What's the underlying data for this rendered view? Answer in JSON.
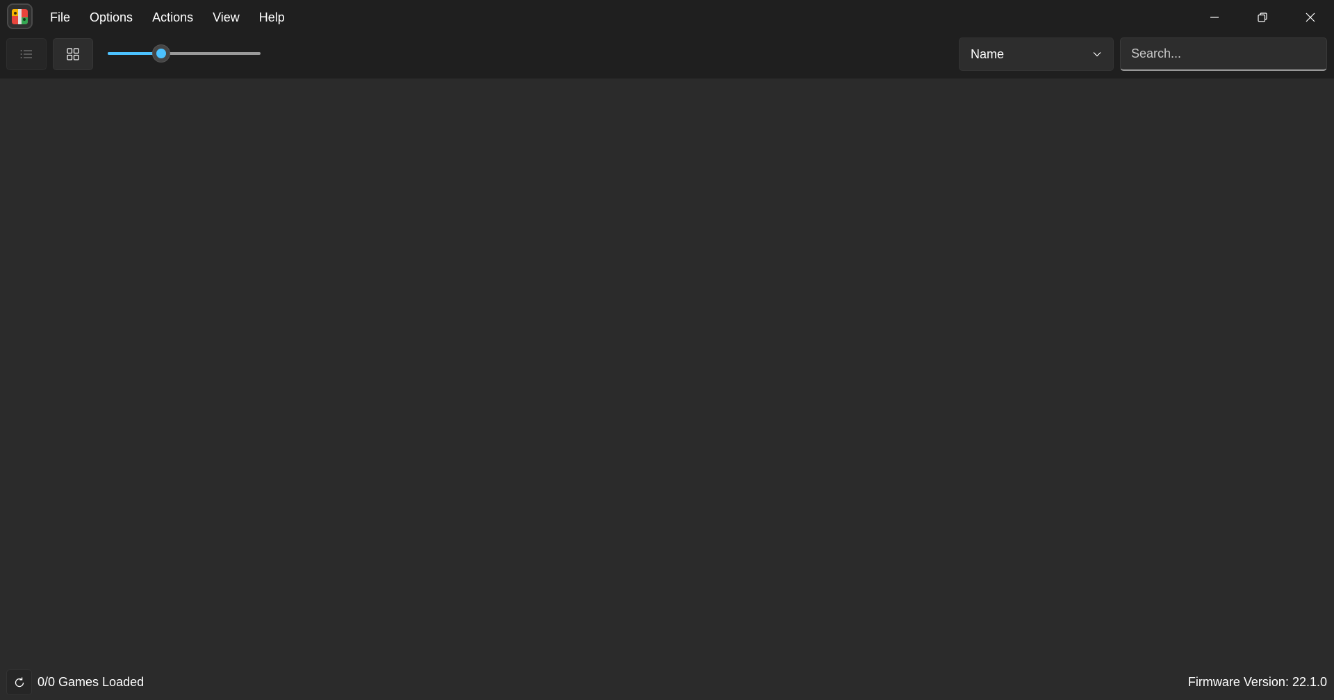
{
  "menu": {
    "items": [
      {
        "label": "File"
      },
      {
        "label": "Options"
      },
      {
        "label": "Actions"
      },
      {
        "label": "View"
      },
      {
        "label": "Help"
      }
    ]
  },
  "window_controls": {
    "minimize_icon": "minimize-icon",
    "restore_icon": "restore-icon",
    "close_icon": "close-icon"
  },
  "toolbar": {
    "list_view_icon": "list-view-icon",
    "grid_view_icon": "grid-view-icon",
    "size_slider_value": 0.35,
    "sort": {
      "selected": "Name"
    },
    "search": {
      "placeholder": "Search...",
      "value": ""
    }
  },
  "status": {
    "games_loaded": "0/0 Games Loaded",
    "firmware": "Firmware Version: 22.1.0",
    "refresh_icon": "refresh-icon"
  },
  "colors": {
    "accent": "#4cc2ff",
    "background": "#2b2b2b",
    "chrome": "#1f1f1f"
  }
}
